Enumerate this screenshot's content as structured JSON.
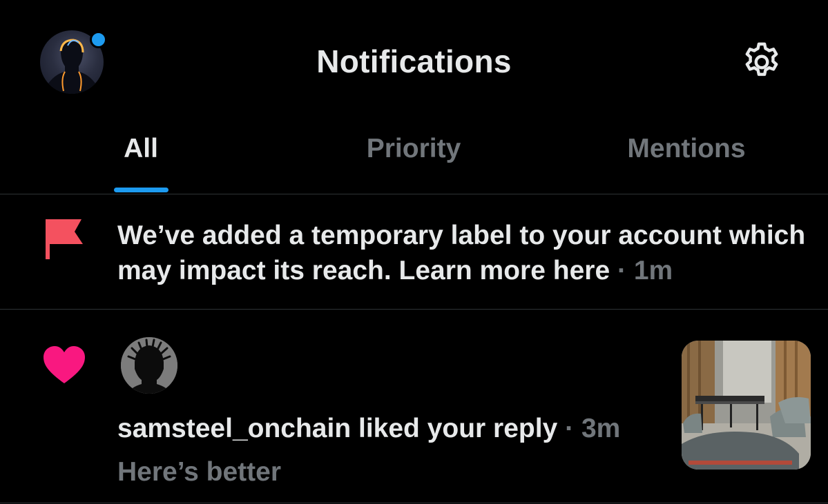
{
  "header": {
    "title": "Notifications",
    "avatar_icon": "profile-avatar",
    "settings_icon": "gear-icon",
    "accent": "#1d9bf0"
  },
  "tabs": [
    {
      "label": "All",
      "active": true
    },
    {
      "label": "Priority",
      "active": false
    },
    {
      "label": "Mentions",
      "active": false
    }
  ],
  "notifications": [
    {
      "type": "label-warning",
      "icon": "flag-icon",
      "icon_color": "#f4515f",
      "text": "We’ve added a temporary label to your account which may impact its reach. Learn more here",
      "time": "1m"
    },
    {
      "type": "like",
      "icon": "heart-icon",
      "icon_color": "#f91880",
      "username": "samsteel_onchain",
      "action": "liked your reply",
      "time": "3m",
      "reply_text": "Here’s better",
      "thumbnail": "image-thumbnail"
    }
  ]
}
